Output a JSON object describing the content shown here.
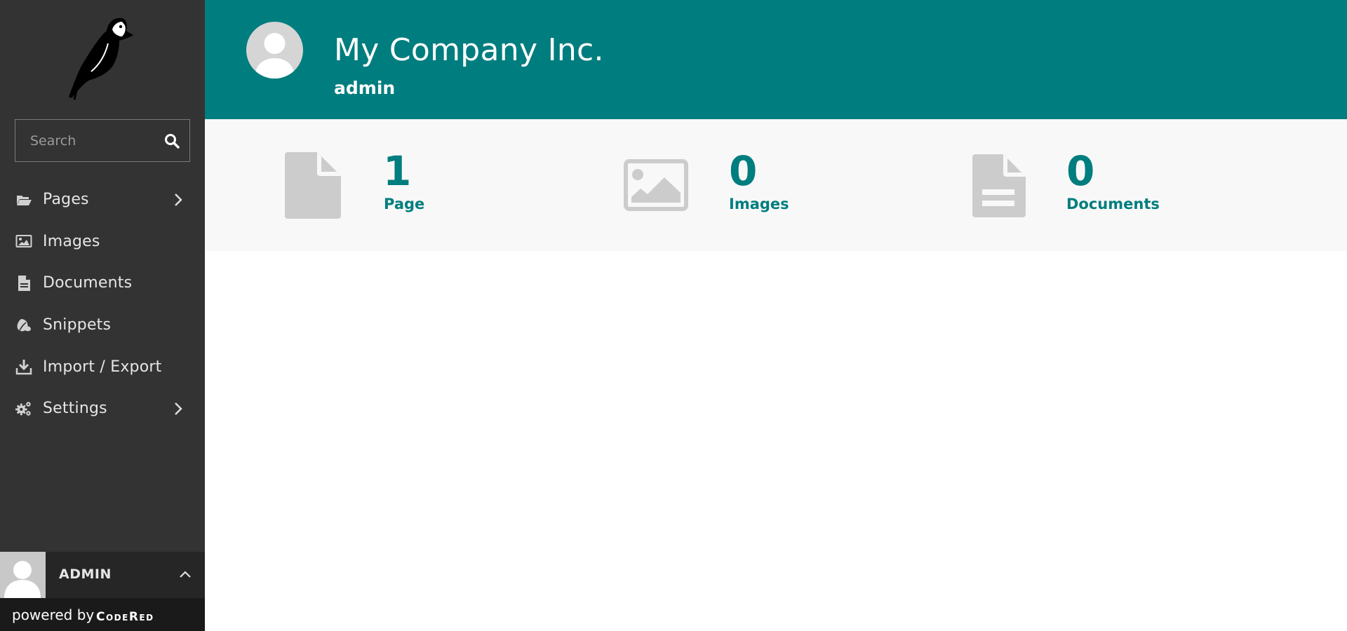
{
  "sidebar": {
    "search": {
      "placeholder": "Search"
    },
    "menu": [
      {
        "label": "Pages",
        "icon": "folder-open-icon",
        "has_submenu": true
      },
      {
        "label": "Images",
        "icon": "image-icon",
        "has_submenu": false
      },
      {
        "label": "Documents",
        "icon": "document-icon",
        "has_submenu": false
      },
      {
        "label": "Snippets",
        "icon": "snippet-icon",
        "has_submenu": false
      },
      {
        "label": "Import / Export",
        "icon": "download-icon",
        "has_submenu": false
      },
      {
        "label": "Settings",
        "icon": "cogs-icon",
        "has_submenu": true
      }
    ],
    "account": {
      "name": "ADMIN"
    },
    "powered_by": {
      "text": "powered by",
      "brand": "CodeRed"
    }
  },
  "header": {
    "site_name": "My Company Inc.",
    "user_name": "admin"
  },
  "stats": [
    {
      "count": "1",
      "label": "Page",
      "icon": "page-icon"
    },
    {
      "count": "0",
      "label": "Images",
      "icon": "image-icon"
    },
    {
      "count": "0",
      "label": "Documents",
      "icon": "document-icon"
    }
  ],
  "colors": {
    "accent": "#007d7e",
    "sidebar": "#333333",
    "stats_background": "#f8f8f8",
    "icon_gray": "#cccccc"
  }
}
